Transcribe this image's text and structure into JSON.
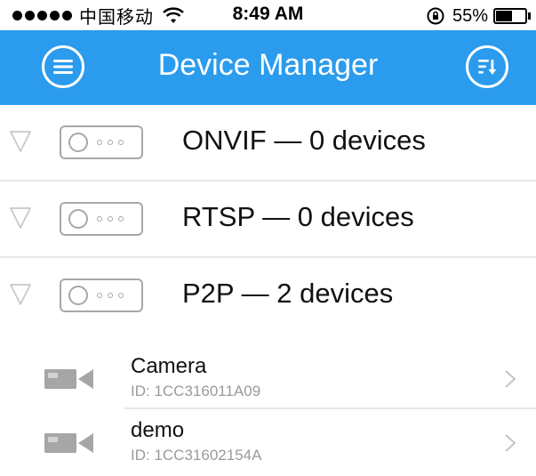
{
  "status_bar": {
    "carrier": "中国移动",
    "time": "8:49 AM",
    "battery": "55%",
    "battery_level": 0.55
  },
  "nav": {
    "title": "Device Manager",
    "left_icon": "menu-icon",
    "right_icon": "sort-icon"
  },
  "groups": [
    {
      "label": "ONVIF — 0 devices"
    },
    {
      "label": "RTSP — 0 devices"
    },
    {
      "label": "P2P — 2 devices"
    }
  ],
  "devices": [
    {
      "name": "Camera",
      "id": "ID: 1CC316011A09"
    },
    {
      "name": "demo",
      "id": "ID: 1CC31602154A"
    }
  ],
  "colors": {
    "nav_bg": "#2b9bed",
    "icon_gray": "#a8a8a8",
    "separator": "#e6e6e6"
  }
}
